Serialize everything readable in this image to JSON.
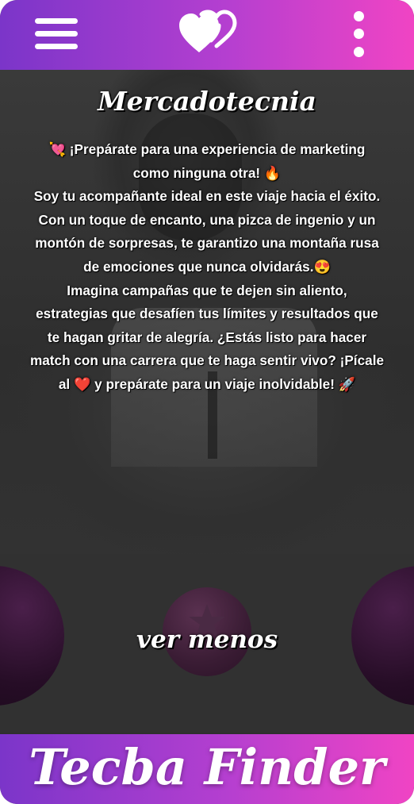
{
  "header": {
    "menu_icon": "hamburger-menu-icon",
    "logo_icon": "double-heart-icon",
    "more_icon": "vertical-dots-icon"
  },
  "card": {
    "title": "Mercadotecnia",
    "description_lines": [
      "💘 ¡Prepárate para una experiencia de marketing",
      "como ninguna otra! 🔥",
      "Soy tu acompañante ideal en este viaje hacia el éxito.",
      "Con un toque de encanto, una pizca de ingenio y un",
      "montón de sorpresas, te garantizo una montaña rusa",
      "de emociones que nunca olvidarás.😍",
      "Imagina campañas que te dejen sin aliento,",
      "estrategias que desafíen tus límites y resultados que",
      "te hagan gritar de alegría.  ¿Estás listo para hacer",
      "match con una carrera que te haga sentir vivo? ¡Pícale",
      "al ❤️ y prepárate para un viaje inolvidable! 🚀"
    ],
    "toggle_label": "ver menos"
  },
  "actions": {
    "left_icon": "dislike-circle-icon",
    "center_icon": "star-icon",
    "right_icon": "like-circle-icon"
  },
  "footer": {
    "brand": "Tecba Finder"
  },
  "colors": {
    "gradient_start": "#7b35c9",
    "gradient_end": "#f044c4",
    "card_background": "#313131"
  }
}
